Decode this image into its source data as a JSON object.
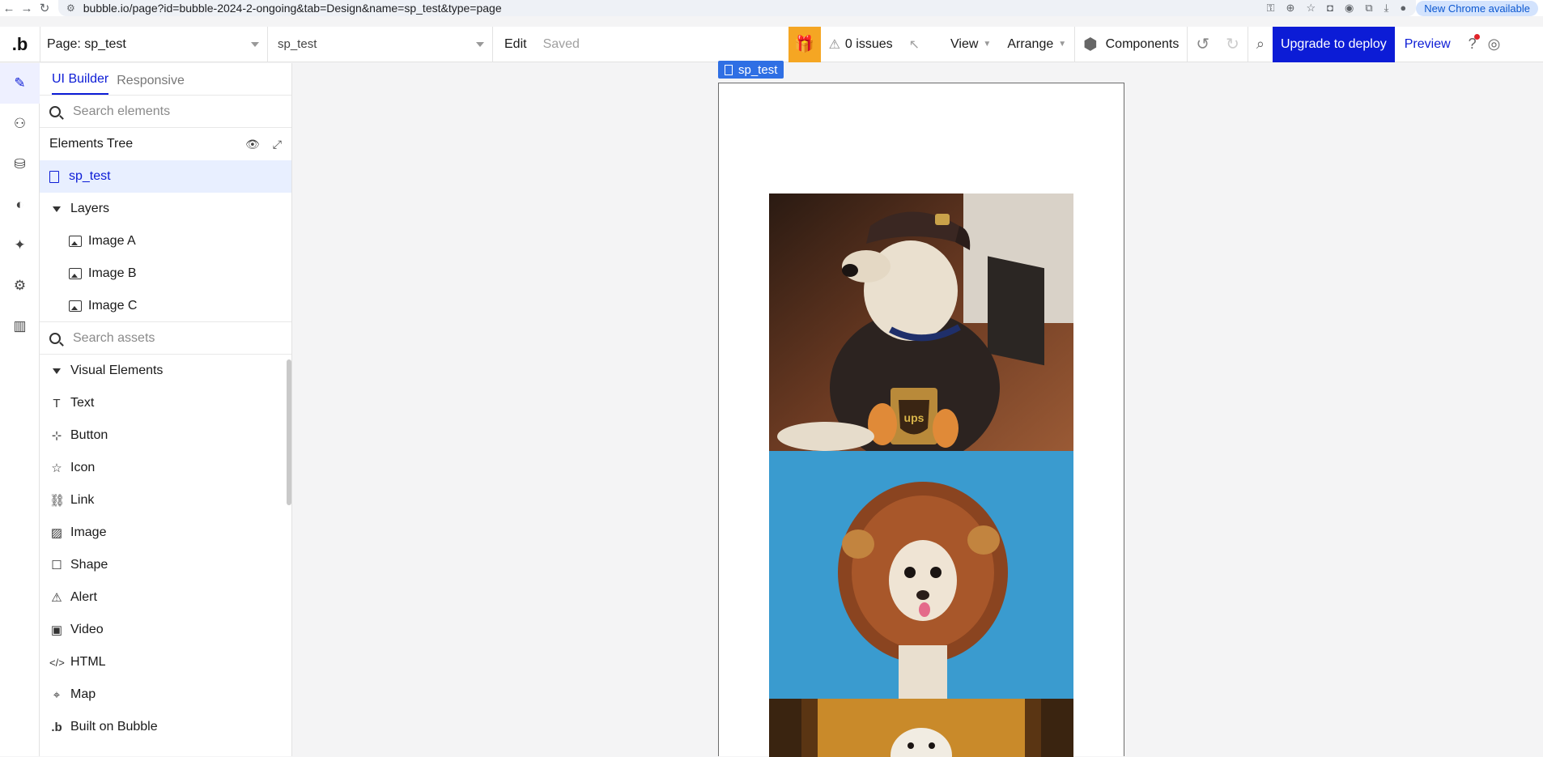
{
  "browser": {
    "url": "bubble.io/page?id=bubble-2024-2-ongoing&tab=Design&name=sp_test&type=page",
    "update_label": "New Chrome available"
  },
  "toolbar": {
    "page_select": "Page: sp_test",
    "element_select": "sp_test",
    "edit": "Edit",
    "saved": "Saved",
    "issues": "0 issues",
    "view": "View",
    "arrange": "Arrange",
    "components": "Components",
    "upgrade": "Upgrade to deploy",
    "preview": "Preview"
  },
  "sidebar": {
    "tabs": [
      "UI Builder",
      "Responsive"
    ],
    "search_elements": "Search elements",
    "elements_tree_title": "Elements Tree",
    "root": "sp_test",
    "layers_label": "Layers",
    "layers": [
      "Image A",
      "Image B",
      "Image C"
    ],
    "search_assets": "Search assets",
    "visual_elements_label": "Visual Elements",
    "visual_elements": [
      {
        "label": "Text",
        "icon": "text-icon"
      },
      {
        "label": "Button",
        "icon": "button-icon"
      },
      {
        "label": "Icon",
        "icon": "star-icon"
      },
      {
        "label": "Link",
        "icon": "link-icon"
      },
      {
        "label": "Image",
        "icon": "image-icon"
      },
      {
        "label": "Shape",
        "icon": "square-icon"
      },
      {
        "label": "Alert",
        "icon": "alert-icon"
      },
      {
        "label": "Video",
        "icon": "video-icon"
      },
      {
        "label": "HTML",
        "icon": "code-icon"
      },
      {
        "label": "Map",
        "icon": "map-pin-icon"
      },
      {
        "label": "Built on Bubble",
        "icon": "bubble-logo-icon"
      }
    ]
  },
  "canvas": {
    "page_label": "sp_test"
  },
  "colors": {
    "accent": "#0c1cd6",
    "gift": "#f5a623",
    "page_label": "#2f6fe4"
  }
}
